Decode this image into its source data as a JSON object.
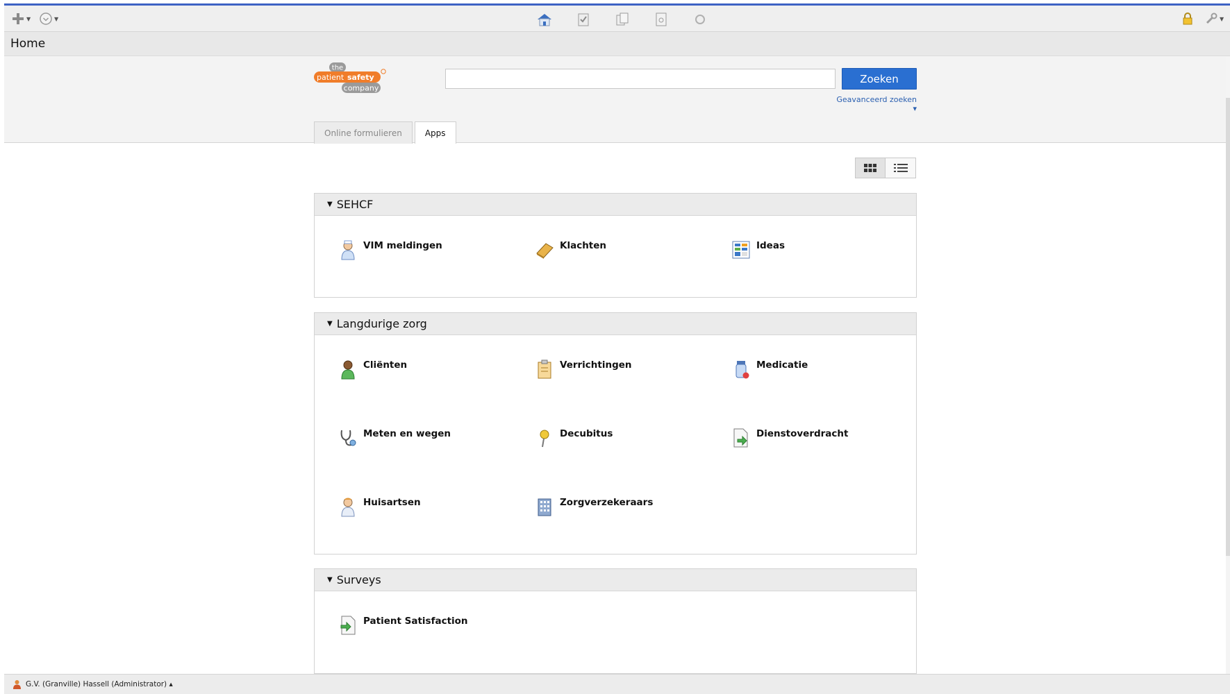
{
  "toolbar": {
    "left_icons": [
      "plus-icon",
      "clock-icon"
    ],
    "center_icons": [
      "home-icon",
      "checklist-icon",
      "documents-icon",
      "report-icon",
      "refresh-icon"
    ],
    "right_icons": [
      "lock-icon",
      "wrench-icon"
    ]
  },
  "page": {
    "title": "Home"
  },
  "logo": {
    "line1": "the",
    "line2a": "patient",
    "line2b": "safety",
    "line3": "company"
  },
  "search": {
    "value": "",
    "placeholder": "",
    "button_label": "Zoeken",
    "advanced_label": "Geavanceerd zoeken ▾"
  },
  "tabs": [
    {
      "label": "Online formulieren",
      "active": false
    },
    {
      "label": "Apps",
      "active": true
    }
  ],
  "view_toggle": [
    "grid-view-icon",
    "list-view-icon"
  ],
  "sections": [
    {
      "title": "SEHCF",
      "apps": [
        {
          "label": "VIM meldingen",
          "icon": "nurse-icon"
        },
        {
          "label": "Klachten",
          "icon": "book-icon"
        },
        {
          "label": "Ideas",
          "icon": "board-icon"
        }
      ]
    },
    {
      "title": "Langdurige zorg",
      "apps": [
        {
          "label": "Cliënten",
          "icon": "client-icon"
        },
        {
          "label": "Verrichtingen",
          "icon": "clipboard-icon"
        },
        {
          "label": "Medicatie",
          "icon": "medication-icon"
        },
        {
          "label": "Meten en wegen",
          "icon": "stethoscope-icon"
        },
        {
          "label": "Decubitus",
          "icon": "pin-icon"
        },
        {
          "label": "Dienstoverdracht",
          "icon": "handover-icon"
        },
        {
          "label": "Huisartsen",
          "icon": "doctor-icon"
        },
        {
          "label": "Zorgverzekeraars",
          "icon": "building-icon"
        }
      ]
    },
    {
      "title": "Surveys",
      "apps": [
        {
          "label": "Patient Satisfaction",
          "icon": "survey-icon"
        }
      ]
    }
  ],
  "status": {
    "user": "G.V. (Granville) Hassell (Administrator) ▴"
  },
  "colors": {
    "accent": "#2a6fd1",
    "top_border": "#3d62c4",
    "logo_orange": "#f07d2a"
  }
}
